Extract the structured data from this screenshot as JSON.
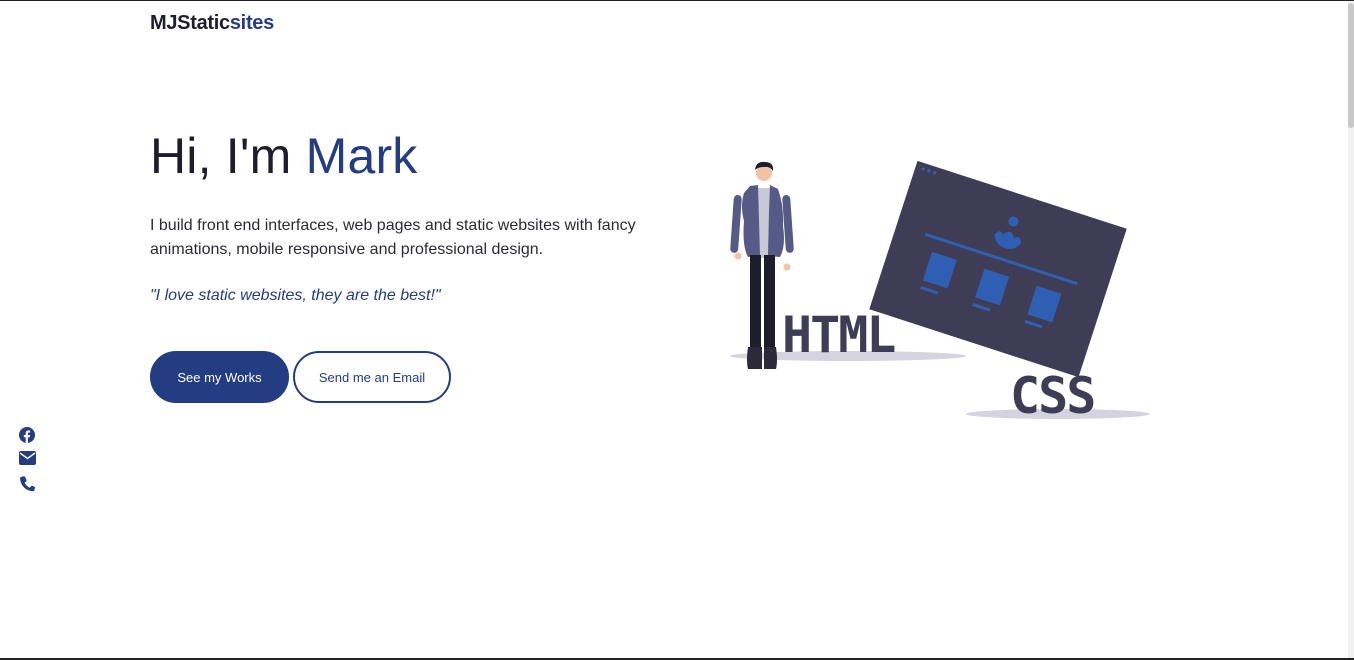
{
  "brand": {
    "name_part1": "MJStatic",
    "name_part2": "sites"
  },
  "hero": {
    "greeting": "Hi, I'm ",
    "name": "Mark",
    "description": "I build front end interfaces, web pages and static websites with fancy animations, mobile responsive and professional design.",
    "quote": "\"I love static websites, they are the best!\""
  },
  "buttons": {
    "works_label": "See my Works",
    "email_label": "Send me an Email"
  },
  "social": {
    "icons": [
      "facebook-icon",
      "envelope-icon",
      "phone-icon"
    ]
  },
  "illustration": {
    "html_text": "HTML",
    "css_text": "CSS"
  },
  "colors": {
    "accent": "#243d82",
    "text_dark": "#1d1d2b",
    "illustration_dark": "#3f3d56",
    "illustration_blue": "#2f5fb3"
  }
}
